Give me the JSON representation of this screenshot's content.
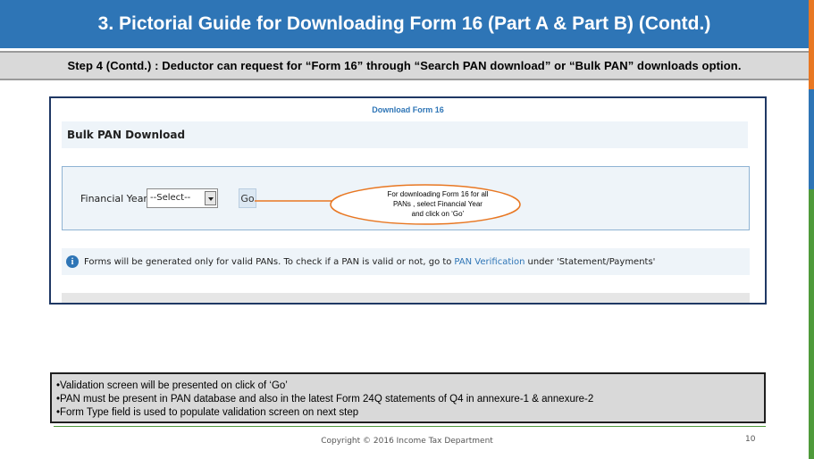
{
  "slide": {
    "title": "3. Pictorial Guide for Downloading Form 16 (Part A & Part B) (Contd.)",
    "step": "Step 4 (Contd.) : Deductor can request for “Form 16” through “Search PAN download” or “Bulk PAN” downloads option.",
    "colors": {
      "title_bg": "#2e75b6",
      "step_bg": "#d9d9d9",
      "accent_orange": "#e87722",
      "accent_green": "#4e9a3a"
    }
  },
  "screenshot": {
    "heading": "Download Form 16",
    "section_title": "Bulk PAN Download",
    "financial_year_label": "Financial Year",
    "required_marker": "*",
    "financial_year_value": "--Select--",
    "go_label": "Go",
    "info_icon": "info-icon",
    "info_text_before": "Forms will be generated only for valid PANs. To check if a PAN is valid or not, go to",
    "info_link": "PAN Verification",
    "info_text_after": "under 'Statement/Payments'"
  },
  "callout": {
    "line1": "For downloading Form 16 for all",
    "line2": "PANs , select Financial Year",
    "line3": "and click on ‘Go’"
  },
  "notes": [
    "•Validation screen will be presented on click of ‘Go’",
    "•PAN must be present in PAN database and also in the latest Form 24Q statements of Q4 in annexure-1 & annexure-2",
    "•Form Type field is used to populate validation screen on next step"
  ],
  "footer": {
    "copyright": "Copyright © 2016 Income Tax Department",
    "page_number": "10"
  }
}
